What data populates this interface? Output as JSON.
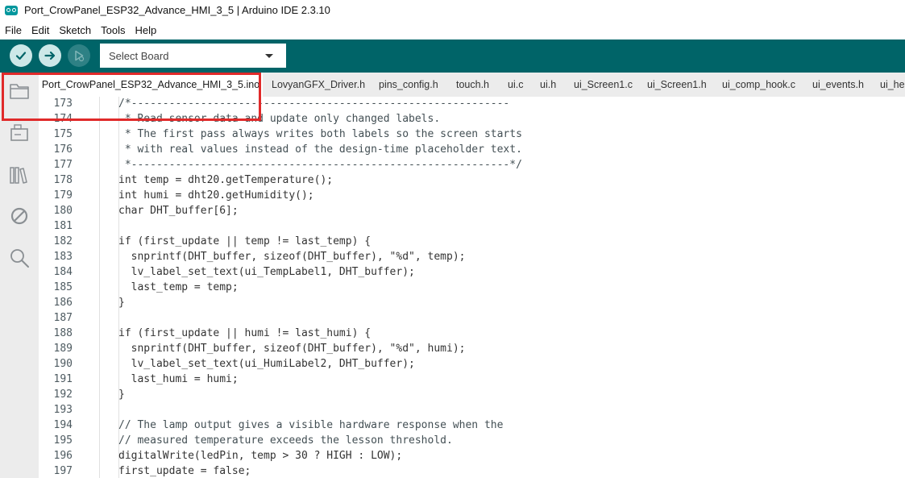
{
  "window": {
    "title": "Port_CrowPanel_ESP32_Advance_HMI_3_5 | Arduino IDE 2.3.10"
  },
  "menu": {
    "items": [
      "File",
      "Edit",
      "Sketch",
      "Tools",
      "Help"
    ]
  },
  "toolbar": {
    "board_select": "Select Board",
    "verify_icon": "check-icon",
    "upload_icon": "arrow-right-icon",
    "debug_icon": "debug-icon"
  },
  "sidebar": {
    "icons": [
      "folder-icon",
      "boards-manager-icon",
      "library-icon",
      "debug-icon",
      "search-icon"
    ]
  },
  "tabs": [
    {
      "label": "Port_CrowPanel_ESP32_Advance_HMI_3_5.ino",
      "active": true
    },
    {
      "label": "LovyanGFX_Driver.h"
    },
    {
      "label": "pins_config.h"
    },
    {
      "label": "touch.h"
    },
    {
      "label": "ui.c"
    },
    {
      "label": "ui.h"
    },
    {
      "label": "ui_Screen1.c"
    },
    {
      "label": "ui_Screen1.h"
    },
    {
      "label": "ui_comp_hook.c"
    },
    {
      "label": "ui_events.h"
    },
    {
      "label": "ui_he"
    }
  ],
  "editor": {
    "lines": [
      {
        "n": "173",
        "text": "/*------------------------------------------------------------",
        "comment": true
      },
      {
        "n": "174",
        "text": " * Read sensor data and update only changed labels.",
        "comment": true
      },
      {
        "n": "175",
        "text": " * The first pass always writes both labels so the screen starts",
        "comment": true
      },
      {
        "n": "176",
        "text": " * with real values instead of the design-time placeholder text.",
        "comment": true
      },
      {
        "n": "177",
        "text": " *------------------------------------------------------------*/",
        "comment": true
      },
      {
        "n": "178",
        "text": "int temp = dht20.getTemperature();"
      },
      {
        "n": "179",
        "text": "int humi = dht20.getHumidity();"
      },
      {
        "n": "180",
        "text": "char DHT_buffer[6];"
      },
      {
        "n": "181",
        "text": ""
      },
      {
        "n": "182",
        "text": "if (first_update || temp != last_temp) {"
      },
      {
        "n": "183",
        "text": "  snprintf(DHT_buffer, sizeof(DHT_buffer), \"%d\", temp);"
      },
      {
        "n": "184",
        "text": "  lv_label_set_text(ui_TempLabel1, DHT_buffer);"
      },
      {
        "n": "185",
        "text": "  last_temp = temp;"
      },
      {
        "n": "186",
        "text": "}"
      },
      {
        "n": "187",
        "text": ""
      },
      {
        "n": "188",
        "text": "if (first_update || humi != last_humi) {"
      },
      {
        "n": "189",
        "text": "  snprintf(DHT_buffer, sizeof(DHT_buffer), \"%d\", humi);"
      },
      {
        "n": "190",
        "text": "  lv_label_set_text(ui_HumiLabel2, DHT_buffer);"
      },
      {
        "n": "191",
        "text": "  last_humi = humi;"
      },
      {
        "n": "192",
        "text": "}"
      },
      {
        "n": "193",
        "text": ""
      },
      {
        "n": "194",
        "text": "// The lamp output gives a visible hardware response when the",
        "comment": true
      },
      {
        "n": "195",
        "text": "// measured temperature exceeds the lesson threshold.",
        "comment": true
      },
      {
        "n": "196",
        "text": "digitalWrite(ledPin, temp > 30 ? HIGH : LOW);"
      },
      {
        "n": "197",
        "text": "first_update = false;"
      }
    ]
  },
  "colors": {
    "toolbar": "#006468",
    "highlight": "#e02a2a"
  }
}
